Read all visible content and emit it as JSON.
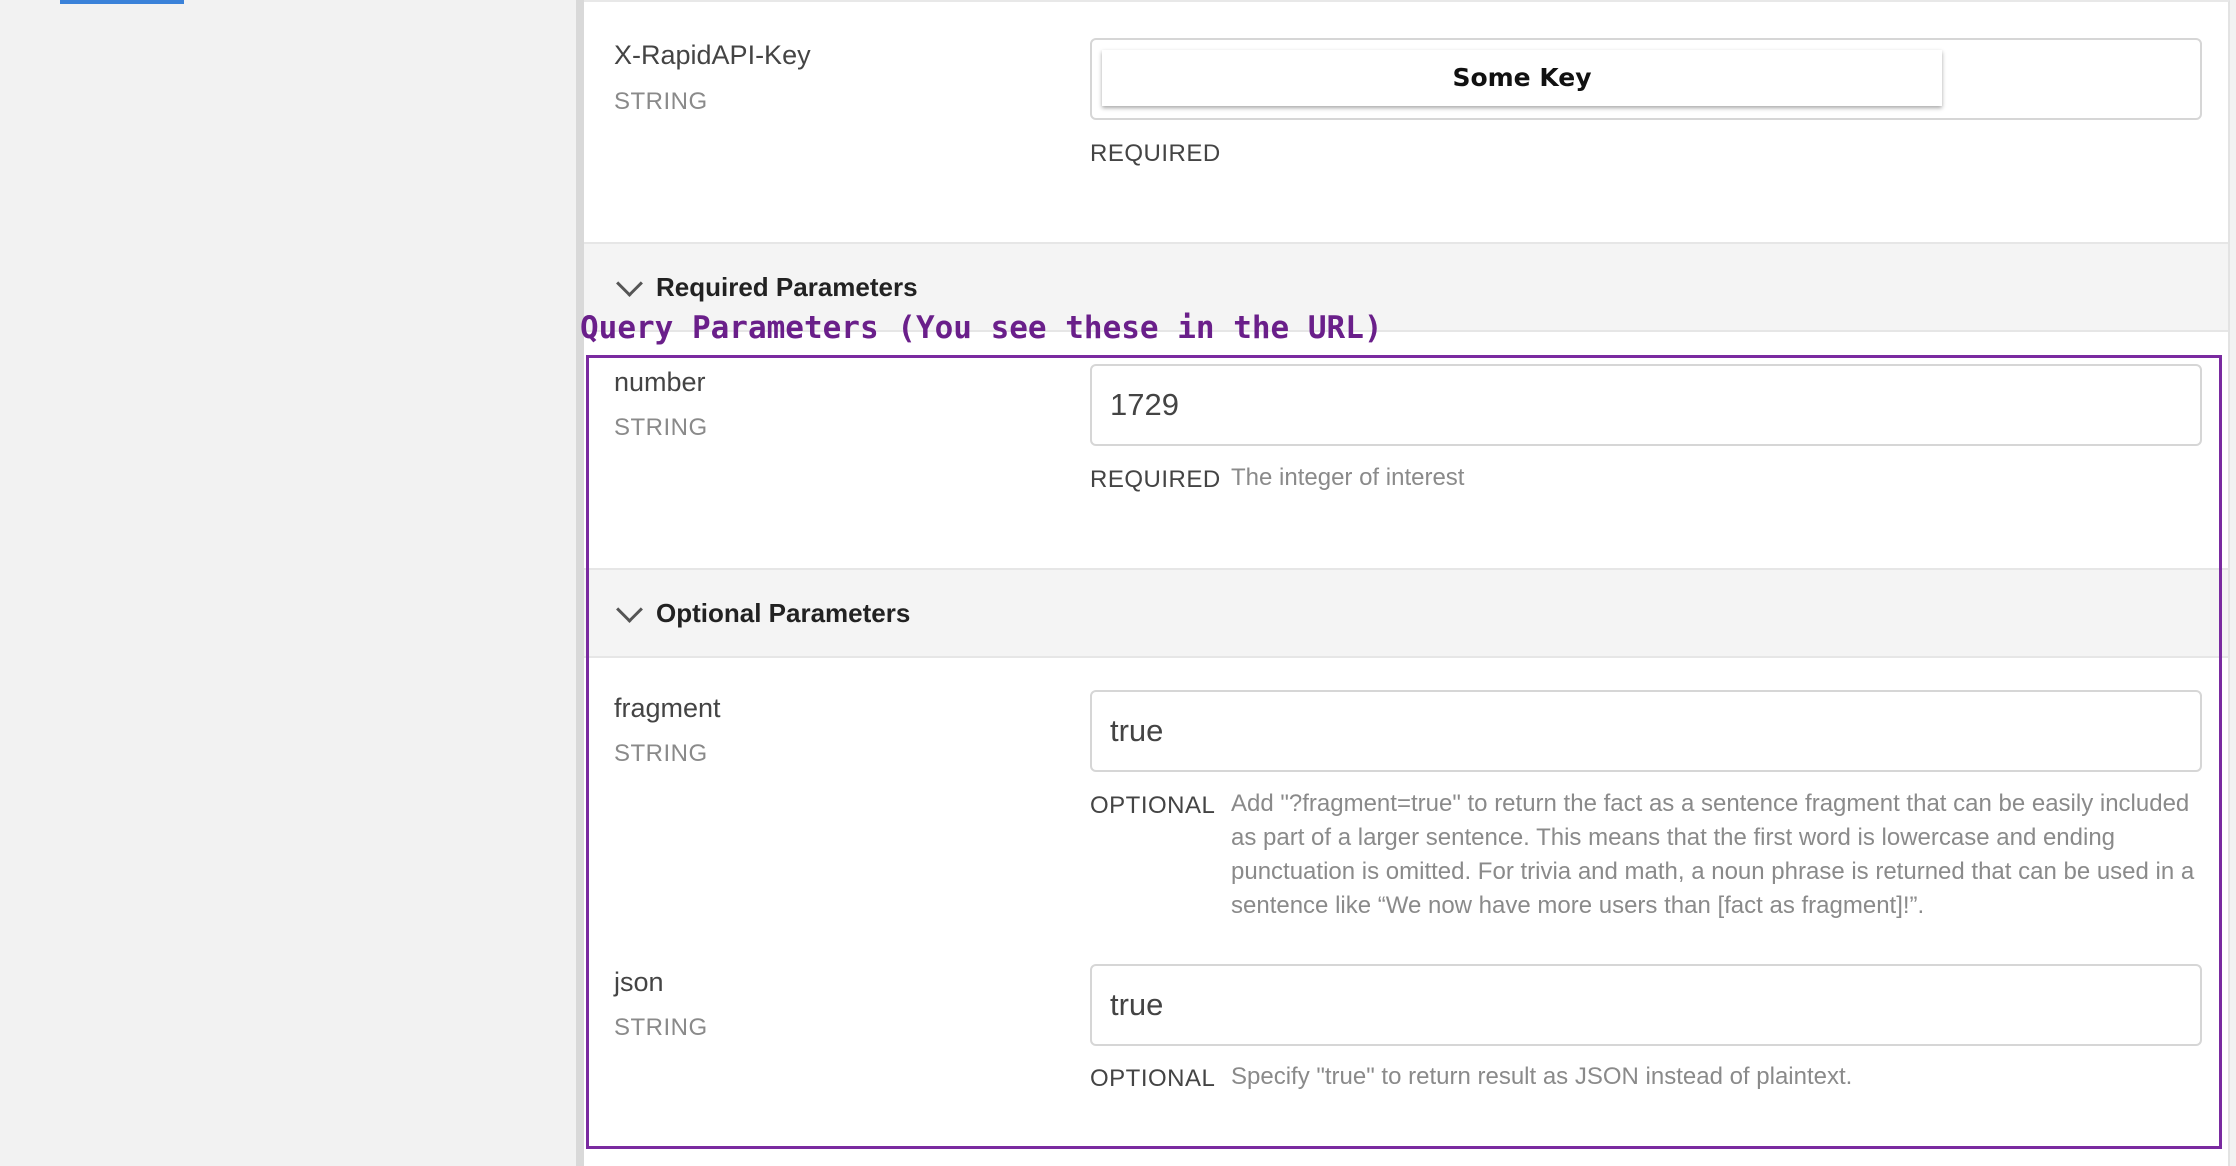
{
  "header_param": {
    "name": "X-RapidAPI-Key",
    "type": "STRING",
    "value": "Some Key",
    "status": "REQUIRED"
  },
  "required_section": {
    "title": "Required Parameters",
    "params": [
      {
        "name": "number",
        "type": "STRING",
        "value": "1729",
        "status": "REQUIRED",
        "description": "The integer of interest"
      }
    ]
  },
  "optional_section": {
    "title": "Optional Parameters",
    "params": [
      {
        "name": "fragment",
        "type": "STRING",
        "value": "true",
        "status": "OPTIONAL",
        "description": "Add \"?fragment=true\" to return the fact as a sentence fragment that can be easily included as part of a larger sentence. This means that the first word is lowercase and ending punctuation is omitted. For trivia and math, a noun phrase is returned that can be used in a sentence like “We now have more users than [fact as fragment]!”."
      },
      {
        "name": "json",
        "type": "STRING",
        "value": "true",
        "status": "OPTIONAL",
        "description": "Specify \"true\" to return result as JSON instead of plaintext."
      }
    ]
  },
  "annotation": {
    "label": "Query Parameters (You see these in the URL)",
    "color": "#6a1f8a"
  },
  "icons": {
    "collapse": "chevron-down-icon"
  }
}
